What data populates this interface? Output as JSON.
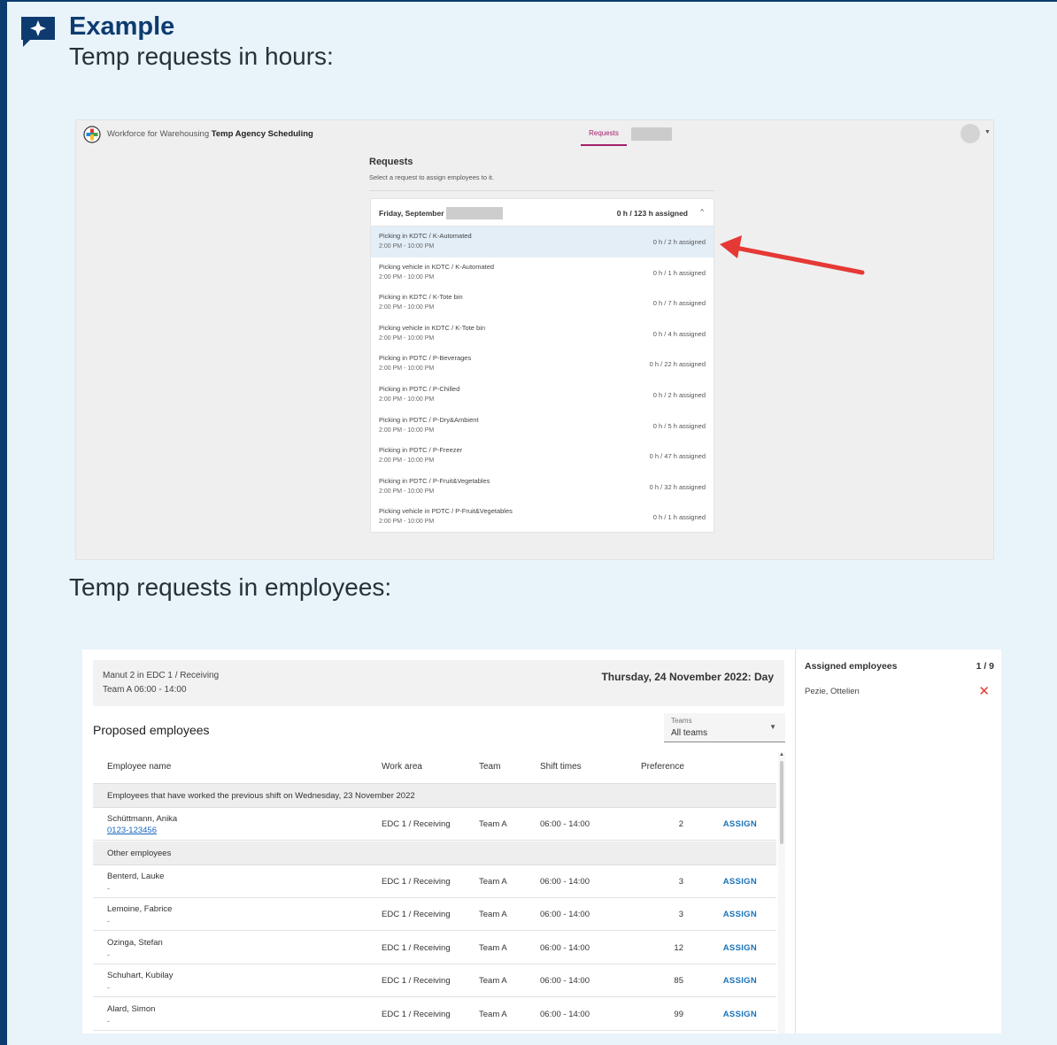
{
  "callout": {
    "title": "Example",
    "text_hours": "Temp requests in hours:",
    "text_employees": "Temp requests in employees:",
    "border_color": "#0d3b70",
    "background_color": "#e9f3fa",
    "icon": "sparkle-speech-bubble-icon"
  },
  "shot1": {
    "app_name_prefix": "Workforce for Warehousing",
    "app_name_bold": "Temp Agency Scheduling",
    "nav_tab": "Requests",
    "header": "Requests",
    "subheader": "Select a request to assign employees to it.",
    "day_title": "Friday, September",
    "day_total": "0 h / 123 h assigned",
    "accent_color": "#a0206b",
    "selected_color": "#e3eef7",
    "requests": [
      {
        "name": "Picking in KDTC / K-Automated",
        "time": "2:00 PM - 10:00 PM",
        "assigned": "0 h / 2 h assigned"
      },
      {
        "name": "Picking vehicle in KDTC / K-Automated",
        "time": "2:00 PM - 10:00 PM",
        "assigned": "0 h / 1 h assigned"
      },
      {
        "name": "Picking in KDTC / K-Tote bin",
        "time": "2:00 PM - 10:00 PM",
        "assigned": "0 h / 7 h assigned"
      },
      {
        "name": "Picking vehicle in KDTC / K-Tote bin",
        "time": "2:00 PM - 10:00 PM",
        "assigned": "0 h / 4 h assigned"
      },
      {
        "name": "Picking in PDTC / P-Beverages",
        "time": "2:00 PM - 10:00 PM",
        "assigned": "0 h / 22 h assigned"
      },
      {
        "name": "Picking in PDTC / P-Chilled",
        "time": "2:00 PM - 10:00 PM",
        "assigned": "0 h / 2 h assigned"
      },
      {
        "name": "Picking in PDTC / P-Dry&Ambient",
        "time": "2:00 PM - 10:00 PM",
        "assigned": "0 h / 5 h assigned"
      },
      {
        "name": "Picking in PDTC / P-Freezer",
        "time": "2:00 PM - 10:00 PM",
        "assigned": "0 h / 47 h assigned"
      },
      {
        "name": "Picking in PDTC / P-Fruit&Vegetables",
        "time": "2:00 PM - 10:00 PM",
        "assigned": "0 h / 32 h assigned"
      },
      {
        "name": "Picking vehicle in PDTC / P-Fruit&Vegetables",
        "time": "2:00 PM - 10:00 PM",
        "assigned": "0 h / 1 h assigned"
      }
    ]
  },
  "shot2": {
    "request_line1": "Manut 2 in EDC 1 / Receiving",
    "request_line2": "Team A 06:00 - 14:00",
    "date": "Thursday, 24 November 2022: Day",
    "proposed_title": "Proposed employees",
    "teams_filter_label": "Teams",
    "teams_filter_value": "All teams",
    "columns": [
      "Employee name",
      "Work area",
      "Team",
      "Shift times",
      "Preference"
    ],
    "group_previous": "Employees that have worked the previous shift on Wednesday, 23 November 2022",
    "group_other": "Other employees",
    "assign_label": "ASSIGN",
    "previous_employees": [
      {
        "name": "Schüttmann, Anika",
        "phone": "0123-123456",
        "area": "EDC 1 / Receiving",
        "team": "Team A",
        "shift": "06:00 - 14:00",
        "preference": "2"
      }
    ],
    "other_employees": [
      {
        "name": "Benterd, Lauke",
        "phone": "-",
        "area": "EDC 1 / Receiving",
        "team": "Team A",
        "shift": "06:00 - 14:00",
        "preference": "3"
      },
      {
        "name": "Lemoine, Fabrice",
        "phone": "-",
        "area": "EDC 1 / Receiving",
        "team": "Team A",
        "shift": "06:00 - 14:00",
        "preference": "3"
      },
      {
        "name": "Ozinga, Stefan",
        "phone": "-",
        "area": "EDC 1 / Receiving",
        "team": "Team A",
        "shift": "06:00 - 14:00",
        "preference": "12"
      },
      {
        "name": "Schuhart, Kubilay",
        "phone": "-",
        "area": "EDC 1 / Receiving",
        "team": "Team A",
        "shift": "06:00 - 14:00",
        "preference": "85"
      },
      {
        "name": "Alard, Simon",
        "phone": "-",
        "area": "EDC 1 / Receiving",
        "team": "Team A",
        "shift": "06:00 - 14:00",
        "preference": "99"
      }
    ],
    "assigned_title": "Assigned employees",
    "assigned_count": "1 / 9",
    "assigned_list": [
      {
        "name": "Pezie, Ottelien"
      }
    ],
    "link_color": "#1a73b8",
    "remove_color": "#e53935"
  }
}
